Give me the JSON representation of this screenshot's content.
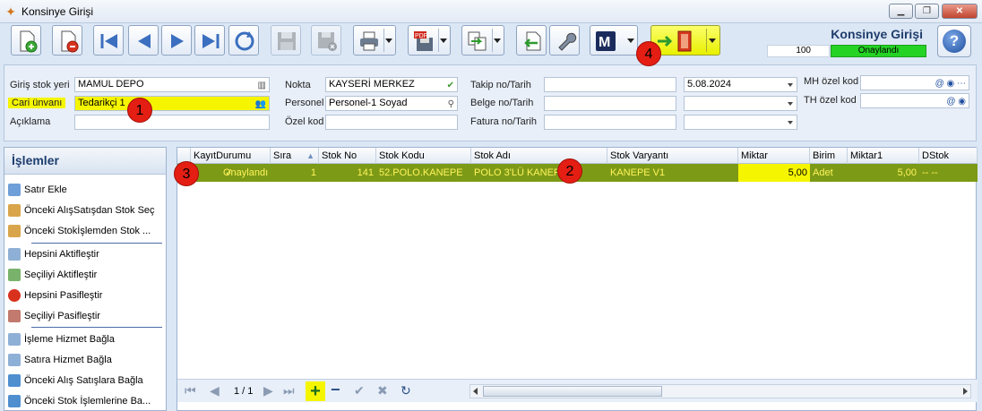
{
  "window": {
    "title": "Konsinye Girişi"
  },
  "header": {
    "form_title": "Konsinye Girişi",
    "counter": "100",
    "status": "Onaylandı"
  },
  "badges": [
    "1",
    "2",
    "3",
    "4"
  ],
  "form": {
    "giris_stok_yeri_label": "Giriş stok yeri",
    "giris_stok_yeri_value": "MAMUL DEPO",
    "cari_unvani_label": "Cari ünvanı",
    "cari_unvani_value": "Tedarikçi 1",
    "aciklama_label": "Açıklama",
    "aciklama_value": "",
    "nokta_label": "Nokta",
    "nokta_value": "KAYSERİ MERKEZ",
    "personel_label": "Personel",
    "personel_value": "Personel-1 Soyad",
    "ozel_kod_label": "Özel kod",
    "ozel_kod_value": "",
    "takip_label": "Takip no/Tarih",
    "takip_value": "",
    "takip_tarih": "5.08.2024",
    "belge_label": "Belge no/Tarih",
    "belge_value": "",
    "belge_tarih": "",
    "fatura_label": "Fatura no/Tarih",
    "fatura_value": "",
    "fatura_tarih": "",
    "mh_label": "MH özel kod",
    "mh_value": "",
    "th_label": "TH özel kod",
    "th_value": ""
  },
  "sidebar": {
    "title": "İşlemler",
    "items": [
      "Satır Ekle",
      "Önceki AlışSatışdan Stok Seç",
      "Önceki Stokİşlemden Stok ...",
      "Hepsini Aktifleştir",
      "Seçiliyi Aktifleştir",
      "Hepsini Pasifleştir",
      "Seçiliyi Pasifleştir",
      "İşleme Hizmet Bağla",
      "Satıra Hizmet Bağla",
      "Önceki Alış Satışlara Bağla",
      "Önceki Stok İşlemlerine Ba..."
    ]
  },
  "grid": {
    "columns": [
      "KayıtDurumu",
      "Sıra",
      "Stok No",
      "Stok Kodu",
      "Stok Adı",
      "Stok Varyantı",
      "Miktar",
      "Birim",
      "Miktar1",
      "DStok"
    ],
    "rows": [
      {
        "kayit": "Onaylandı",
        "sira": "1",
        "stok_no": "141",
        "stok_kodu": "52.POLO.KANEPE",
        "stok_adi": "POLO 3'LÜ KANEPE",
        "varyant": "KANEPE V1",
        "miktar": "5,00",
        "birim": "Adet",
        "miktar1": "5,00",
        "dstok": "-- --"
      }
    ],
    "page_info": "1 / 1"
  }
}
